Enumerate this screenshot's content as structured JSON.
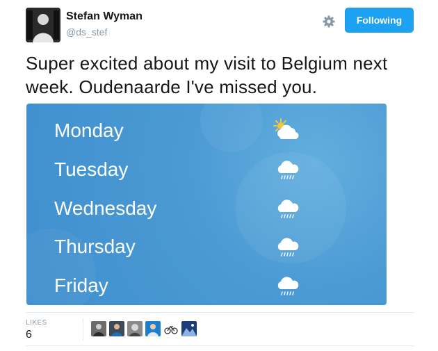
{
  "tweet": {
    "author_name": "Stefan Wyman",
    "author_handle": "@ds_stef",
    "follow_label": "Following",
    "text": "Super excited about my visit to Belgium next week. Oudenaarde I've missed you."
  },
  "forecast": {
    "days": [
      {
        "day": "Monday",
        "icon": "partly-sunny-icon"
      },
      {
        "day": "Tuesday",
        "icon": "rain-cloud-icon"
      },
      {
        "day": "Wednesday",
        "icon": "rain-cloud-icon"
      },
      {
        "day": "Thursday",
        "icon": "rain-cloud-icon"
      },
      {
        "day": "Friday",
        "icon": "rain-cloud-icon"
      }
    ]
  },
  "stats": {
    "likes_label": "LIKES",
    "likes_count": "6"
  },
  "colors": {
    "accent": "#1da1f2",
    "weather_bg": "#4b9ad4"
  }
}
